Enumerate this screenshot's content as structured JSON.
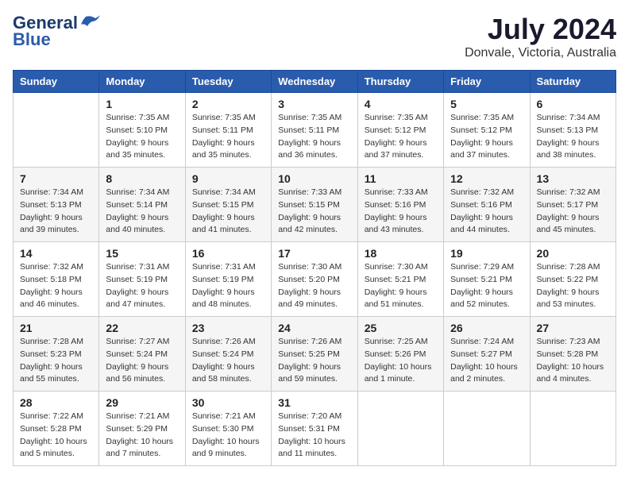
{
  "app": {
    "name": "GeneralBlue",
    "logo_line1": "General",
    "logo_line2": "Blue"
  },
  "calendar": {
    "month_year": "July 2024",
    "location": "Donvale, Victoria, Australia",
    "days_of_week": [
      "Sunday",
      "Monday",
      "Tuesday",
      "Wednesday",
      "Thursday",
      "Friday",
      "Saturday"
    ],
    "weeks": [
      [
        {
          "day": "",
          "sunrise": "",
          "sunset": "",
          "daylight": ""
        },
        {
          "day": "1",
          "sunrise": "Sunrise: 7:35 AM",
          "sunset": "Sunset: 5:10 PM",
          "daylight": "Daylight: 9 hours and 35 minutes."
        },
        {
          "day": "2",
          "sunrise": "Sunrise: 7:35 AM",
          "sunset": "Sunset: 5:11 PM",
          "daylight": "Daylight: 9 hours and 35 minutes."
        },
        {
          "day": "3",
          "sunrise": "Sunrise: 7:35 AM",
          "sunset": "Sunset: 5:11 PM",
          "daylight": "Daylight: 9 hours and 36 minutes."
        },
        {
          "day": "4",
          "sunrise": "Sunrise: 7:35 AM",
          "sunset": "Sunset: 5:12 PM",
          "daylight": "Daylight: 9 hours and 37 minutes."
        },
        {
          "day": "5",
          "sunrise": "Sunrise: 7:35 AM",
          "sunset": "Sunset: 5:12 PM",
          "daylight": "Daylight: 9 hours and 37 minutes."
        },
        {
          "day": "6",
          "sunrise": "Sunrise: 7:34 AM",
          "sunset": "Sunset: 5:13 PM",
          "daylight": "Daylight: 9 hours and 38 minutes."
        }
      ],
      [
        {
          "day": "7",
          "sunrise": "Sunrise: 7:34 AM",
          "sunset": "Sunset: 5:13 PM",
          "daylight": "Daylight: 9 hours and 39 minutes."
        },
        {
          "day": "8",
          "sunrise": "Sunrise: 7:34 AM",
          "sunset": "Sunset: 5:14 PM",
          "daylight": "Daylight: 9 hours and 40 minutes."
        },
        {
          "day": "9",
          "sunrise": "Sunrise: 7:34 AM",
          "sunset": "Sunset: 5:15 PM",
          "daylight": "Daylight: 9 hours and 41 minutes."
        },
        {
          "day": "10",
          "sunrise": "Sunrise: 7:33 AM",
          "sunset": "Sunset: 5:15 PM",
          "daylight": "Daylight: 9 hours and 42 minutes."
        },
        {
          "day": "11",
          "sunrise": "Sunrise: 7:33 AM",
          "sunset": "Sunset: 5:16 PM",
          "daylight": "Daylight: 9 hours and 43 minutes."
        },
        {
          "day": "12",
          "sunrise": "Sunrise: 7:32 AM",
          "sunset": "Sunset: 5:16 PM",
          "daylight": "Daylight: 9 hours and 44 minutes."
        },
        {
          "day": "13",
          "sunrise": "Sunrise: 7:32 AM",
          "sunset": "Sunset: 5:17 PM",
          "daylight": "Daylight: 9 hours and 45 minutes."
        }
      ],
      [
        {
          "day": "14",
          "sunrise": "Sunrise: 7:32 AM",
          "sunset": "Sunset: 5:18 PM",
          "daylight": "Daylight: 9 hours and 46 minutes."
        },
        {
          "day": "15",
          "sunrise": "Sunrise: 7:31 AM",
          "sunset": "Sunset: 5:19 PM",
          "daylight": "Daylight: 9 hours and 47 minutes."
        },
        {
          "day": "16",
          "sunrise": "Sunrise: 7:31 AM",
          "sunset": "Sunset: 5:19 PM",
          "daylight": "Daylight: 9 hours and 48 minutes."
        },
        {
          "day": "17",
          "sunrise": "Sunrise: 7:30 AM",
          "sunset": "Sunset: 5:20 PM",
          "daylight": "Daylight: 9 hours and 49 minutes."
        },
        {
          "day": "18",
          "sunrise": "Sunrise: 7:30 AM",
          "sunset": "Sunset: 5:21 PM",
          "daylight": "Daylight: 9 hours and 51 minutes."
        },
        {
          "day": "19",
          "sunrise": "Sunrise: 7:29 AM",
          "sunset": "Sunset: 5:21 PM",
          "daylight": "Daylight: 9 hours and 52 minutes."
        },
        {
          "day": "20",
          "sunrise": "Sunrise: 7:28 AM",
          "sunset": "Sunset: 5:22 PM",
          "daylight": "Daylight: 9 hours and 53 minutes."
        }
      ],
      [
        {
          "day": "21",
          "sunrise": "Sunrise: 7:28 AM",
          "sunset": "Sunset: 5:23 PM",
          "daylight": "Daylight: 9 hours and 55 minutes."
        },
        {
          "day": "22",
          "sunrise": "Sunrise: 7:27 AM",
          "sunset": "Sunset: 5:24 PM",
          "daylight": "Daylight: 9 hours and 56 minutes."
        },
        {
          "day": "23",
          "sunrise": "Sunrise: 7:26 AM",
          "sunset": "Sunset: 5:24 PM",
          "daylight": "Daylight: 9 hours and 58 minutes."
        },
        {
          "day": "24",
          "sunrise": "Sunrise: 7:26 AM",
          "sunset": "Sunset: 5:25 PM",
          "daylight": "Daylight: 9 hours and 59 minutes."
        },
        {
          "day": "25",
          "sunrise": "Sunrise: 7:25 AM",
          "sunset": "Sunset: 5:26 PM",
          "daylight": "Daylight: 10 hours and 1 minute."
        },
        {
          "day": "26",
          "sunrise": "Sunrise: 7:24 AM",
          "sunset": "Sunset: 5:27 PM",
          "daylight": "Daylight: 10 hours and 2 minutes."
        },
        {
          "day": "27",
          "sunrise": "Sunrise: 7:23 AM",
          "sunset": "Sunset: 5:28 PM",
          "daylight": "Daylight: 10 hours and 4 minutes."
        }
      ],
      [
        {
          "day": "28",
          "sunrise": "Sunrise: 7:22 AM",
          "sunset": "Sunset: 5:28 PM",
          "daylight": "Daylight: 10 hours and 5 minutes."
        },
        {
          "day": "29",
          "sunrise": "Sunrise: 7:21 AM",
          "sunset": "Sunset: 5:29 PM",
          "daylight": "Daylight: 10 hours and 7 minutes."
        },
        {
          "day": "30",
          "sunrise": "Sunrise: 7:21 AM",
          "sunset": "Sunset: 5:30 PM",
          "daylight": "Daylight: 10 hours and 9 minutes."
        },
        {
          "day": "31",
          "sunrise": "Sunrise: 7:20 AM",
          "sunset": "Sunset: 5:31 PM",
          "daylight": "Daylight: 10 hours and 11 minutes."
        },
        {
          "day": "",
          "sunrise": "",
          "sunset": "",
          "daylight": ""
        },
        {
          "day": "",
          "sunrise": "",
          "sunset": "",
          "daylight": ""
        },
        {
          "day": "",
          "sunrise": "",
          "sunset": "",
          "daylight": ""
        }
      ]
    ]
  }
}
